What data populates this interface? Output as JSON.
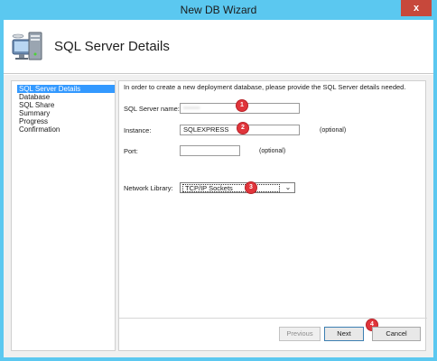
{
  "window": {
    "title": "New DB Wizard",
    "close_label": "x"
  },
  "header": {
    "title": "SQL Server Details",
    "icon": "computer-database-icon"
  },
  "sidebar": {
    "items": [
      {
        "label": "SQL Server Details",
        "active": true
      },
      {
        "label": "Database",
        "active": false
      },
      {
        "label": "SQL Share",
        "active": false
      },
      {
        "label": "Summary",
        "active": false
      },
      {
        "label": "Progress",
        "active": false
      },
      {
        "label": "Confirmation",
        "active": false
      }
    ]
  },
  "form": {
    "intro": "In order to create a new deployment database, please provide the SQL Server details needed.",
    "server_name_label": "SQL Server name:",
    "server_name_value": "•••••••",
    "instance_label": "Instance:",
    "instance_value": "SQLEXPRESS",
    "instance_optional": "(optional)",
    "port_label": "Port:",
    "port_value": "",
    "port_optional": "(optional)",
    "network_library_label": "Network Library:",
    "network_library_value": "TCP/IP Sockets"
  },
  "markers": [
    "1",
    "2",
    "3",
    "4"
  ],
  "buttons": {
    "previous": "Previous",
    "next": "Next",
    "cancel": "Cancel"
  },
  "colors": {
    "title_bar": "#5bc8f0",
    "selection": "#3399ff",
    "marker": "#e0353b",
    "close": "#c7483b"
  }
}
